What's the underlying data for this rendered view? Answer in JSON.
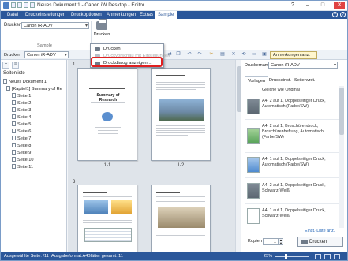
{
  "window": {
    "title": "Neues Dokument 1 - Canon iW Desktop - Editor",
    "controls": [
      "?",
      "–",
      "□",
      "✕"
    ]
  },
  "ribbon": {
    "tabs": [
      "Datei",
      "Druckeinstellungen",
      "Druckoptionen",
      "Anmerkungen",
      "Extras",
      "Sample"
    ],
    "active_tab": "Sample",
    "printer_label": "Drucker:",
    "printer_value": "Canon iR-ADV",
    "print_button_label": "Drucken",
    "group_label": "Sample"
  },
  "print_menu": {
    "items": [
      "Drucken",
      "Druckvorschau mit Einstellungen",
      "Druckdialog anzeigen..."
    ],
    "highlighted_index": 2
  },
  "toolbar": {
    "printer_label": "Drucker",
    "printer_value": "Canon iR-ADV",
    "annotations_toggle": "Anmerkungen anz."
  },
  "left_panel": {
    "title": "Seitenliste",
    "tree": [
      {
        "label": "Neues Dokument 1",
        "level": 0
      },
      {
        "label": "[Kapitel1] Summary of Re",
        "level": 1
      },
      {
        "label": "Seite 1",
        "level": 2
      },
      {
        "label": "Seite 2",
        "level": 2
      },
      {
        "label": "Seite 3",
        "level": 2
      },
      {
        "label": "Seite 4",
        "level": 2
      },
      {
        "label": "Seite 5",
        "level": 2
      },
      {
        "label": "Seite 6",
        "level": 2
      },
      {
        "label": "Seite 7",
        "level": 2
      },
      {
        "label": "Seite 8",
        "level": 2
      },
      {
        "label": "Seite 9",
        "level": 2
      },
      {
        "label": "Seite 10",
        "level": 2
      },
      {
        "label": "Seite 11",
        "level": 2
      }
    ]
  },
  "center": {
    "sheets": [
      {
        "number": "1",
        "pages": [
          "1-1",
          "1-2"
        ]
      },
      {
        "number": "3",
        "pages": [
          "",
          ""
        ]
      }
    ],
    "page_title": "Summary of Research"
  },
  "right_panel": {
    "printer_label": "Druckername:",
    "printer_value": "Canon iR-ADV",
    "tabs": [
      "Vorlagen",
      "Druckeinst.",
      "Seitenvrst."
    ],
    "active_tab": "Vorlagen",
    "presets": [
      "Gleiche wie Original",
      "A4, 2 auf 1, Doppelseitiger Druck, Automatisch (Farbe/SW)",
      "A4, 2 auf 1, Broschürendruck, Broschürenheftung, Automatisch (Farbe/SW)",
      "A4, 1 auf 1, Doppelseitiger Druck, Automatisch (Farbe/SW)",
      "A4, 2 auf 1, Doppelseitiger Druck, Schwarz-Weiß",
      "A4, 1 auf 1, Doppelseitiger Druck, Schwarz-Weiß"
    ],
    "custom_link": "Einst.-Liste anz.",
    "copies_label": "Kopien",
    "copies_value": "1",
    "print_button": "Drucken"
  },
  "status_bar": {
    "current_page": "Ausgewählte Seite: /11",
    "output_format": "Ausgabeformat:A4",
    "sheets_total": "Blätter gesamt: 11",
    "zoom": "25%"
  },
  "colors": {
    "accent": "#2b579a",
    "highlight": "#e02020"
  }
}
